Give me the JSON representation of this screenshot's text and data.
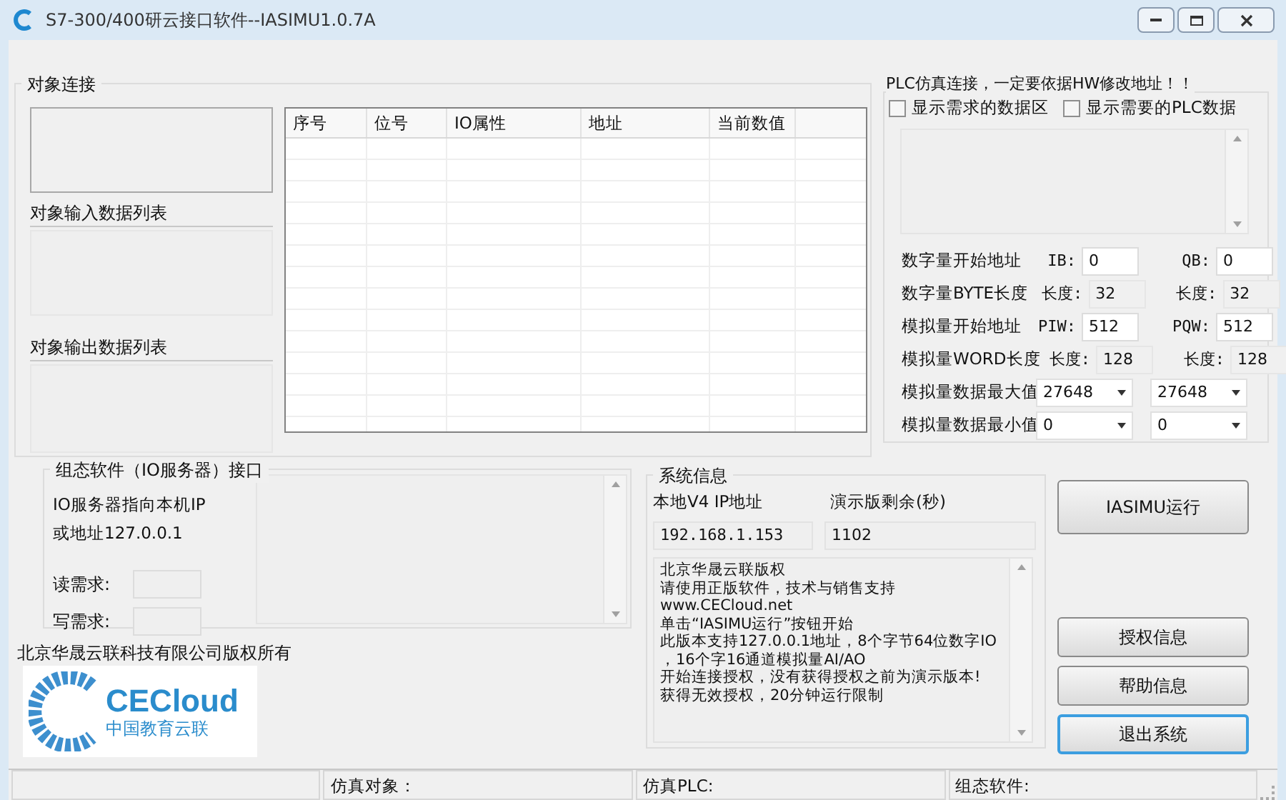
{
  "window": {
    "title": "S7-300/400研云接口软件--IASIMU1.0.7A"
  },
  "object_group": {
    "title": "对象连接",
    "input_list_label": "对象输入数据列表",
    "output_list_label": "对象输出数据列表"
  },
  "table": {
    "columns": [
      "序号",
      "位号",
      "IO属性",
      "地址",
      "当前数值"
    ]
  },
  "plc_group": {
    "title": "PLC仿真连接，一定要依据HW修改地址！！",
    "checkboxes": [
      {
        "label": "显示需求的数据区",
        "checked": false
      },
      {
        "label": "显示需要的PLC数据",
        "checked": false
      }
    ],
    "rows": [
      {
        "label": "数字量开始地址",
        "fields": [
          {
            "prefix": "IB:",
            "value": "0",
            "kind": "input"
          },
          {
            "prefix": "QB:",
            "value": "0",
            "kind": "input"
          }
        ]
      },
      {
        "label": "数字量BYTE长度",
        "fields": [
          {
            "prefix": "长度:",
            "value": "32",
            "kind": "readonly"
          },
          {
            "prefix": "长度:",
            "value": "32",
            "kind": "readonly"
          }
        ]
      },
      {
        "label": "模拟量开始地址",
        "fields": [
          {
            "prefix": "PIW:",
            "value": "512",
            "kind": "input"
          },
          {
            "prefix": "PQW:",
            "value": "512",
            "kind": "input"
          }
        ]
      },
      {
        "label": "模拟量WORD长度",
        "fields": [
          {
            "prefix": "长度:",
            "value": "128",
            "kind": "readonly"
          },
          {
            "prefix": "长度:",
            "value": "128",
            "kind": "readonly"
          }
        ]
      },
      {
        "label": "模拟量数据最大值",
        "fields": [
          {
            "value": "27648",
            "kind": "combo"
          },
          {
            "value": "27648",
            "kind": "combo"
          }
        ]
      },
      {
        "label": "模拟量数据最小值",
        "fields": [
          {
            "value": "0",
            "kind": "combo"
          },
          {
            "value": "0",
            "kind": "combo"
          }
        ]
      }
    ]
  },
  "scada_group": {
    "title": "组态软件（IO服务器）接口",
    "lines": [
      "IO服务器指向本机IP",
      "或地址127.0.0.1"
    ],
    "read_label": "读需求:",
    "write_label": "写需求:"
  },
  "copyright": "北京华晟云联科技有限公司版权所有",
  "logo": {
    "name": "CECloud",
    "tagline": "中国教育云联"
  },
  "system_info": {
    "title": "系统信息",
    "ip_label": "本地V4 IP地址",
    "ip_value": "192.168.1.153",
    "remaining_label": "演示版剩余(秒)",
    "remaining_value": "1102",
    "messages": [
      "北京华晟云联版权",
      "请使用正版软件，技术与销售支持",
      "www.CECloud.net",
      "单击“IASIMU运行”按钮开始",
      "此版本支持127.0.0.1地址，8个字节64位数字IO",
      "，16个字16通道模拟量AI/AO",
      "开始连接授权，没有获得授权之前为演示版本!",
      "获得无效授权，20分钟运行限制"
    ]
  },
  "buttons": [
    {
      "label": "IASIMU运行",
      "focused": false
    },
    {
      "label": "授权信息",
      "focused": false
    },
    {
      "label": "帮助信息",
      "focused": false
    },
    {
      "label": "退出系统",
      "focused": true
    }
  ],
  "status_bar": [
    "仿真对象：",
    "仿真PLC:",
    "组态软件:"
  ]
}
